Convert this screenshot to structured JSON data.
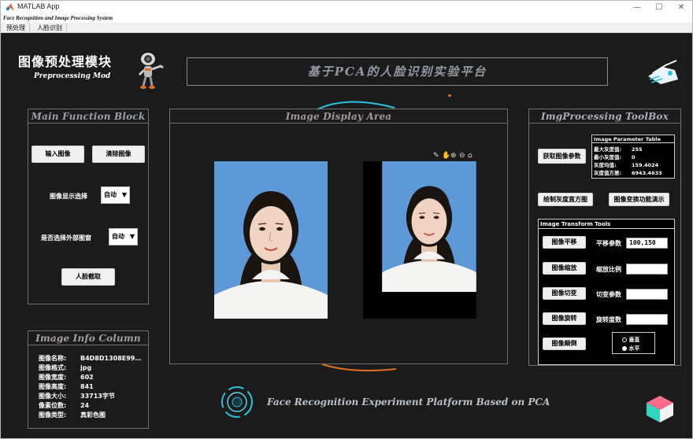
{
  "window": {
    "title": "MATLAB App",
    "figure_name": "Face Recognition and Image Processing System"
  },
  "window_controls": {
    "minimize": "—",
    "maximize": "☐",
    "close": "✕"
  },
  "menu": [
    "预处理",
    "人脸识别"
  ],
  "header": {
    "module_title": "图像预处理模块",
    "module_subtitle": "Preprocessing Mod",
    "banner_title": "基于PCA的人脸识别实验平台"
  },
  "main_function": {
    "title": "Main Function Block",
    "input_button": "输入图像",
    "clear_button": "清除图像",
    "display_select_label": "图像显示选择",
    "display_select_value": "自动",
    "external_window_label": "是否选择外部图窗",
    "external_window_value": "自动",
    "face_crop_button": "人脸截取"
  },
  "image_info": {
    "title": "Image Info Column",
    "rows": [
      {
        "key": "图像名称:",
        "value": "B4D8D1308E99…"
      },
      {
        "key": "图像格式:",
        "value": "jpg"
      },
      {
        "key": "图像宽度:",
        "value": "602"
      },
      {
        "key": "图像高度:",
        "value": "841"
      },
      {
        "key": "图像大小:",
        "value": "33713字节"
      },
      {
        "key": "像素位数:",
        "value": "24"
      },
      {
        "key": "图像类型:",
        "value": "真彩色图"
      }
    ]
  },
  "display_area": {
    "title": "Image Display Area",
    "toolbar_icons": [
      "brush-icon",
      "pan-icon",
      "zoom-in-icon",
      "zoom-out-icon",
      "home-icon"
    ]
  },
  "toolbox": {
    "title": "ImgProcessing ToolBox",
    "get_params_button": "获取图像参数",
    "param_table": {
      "title": "Image Parameter Table",
      "rows": [
        {
          "key": "最大灰度值:",
          "value": "255"
        },
        {
          "key": "最小灰度值:",
          "value": "0"
        },
        {
          "key": "灰度均值:",
          "value": "159.4024"
        },
        {
          "key": "灰度值方差:",
          "value": "6943.4633"
        }
      ]
    },
    "histogram_button": "绘制灰度直方图",
    "transform_demo_button": "图像变换功能演示"
  },
  "transform_tools": {
    "title": "Image Transform Tools",
    "translate_button": "图像平移",
    "translate_label": "平移参数",
    "translate_value": "100,150",
    "scale_button": "图像缩放",
    "scale_label": "缩放比例",
    "scale_value": "",
    "shear_button": "图像切变",
    "shear_label": "切变参数",
    "shear_value": "",
    "rotate_button": "图像旋转",
    "rotate_label": "旋转度数",
    "rotate_value": "",
    "flip_button": "图像颠倒",
    "flip_options": [
      "垂直",
      "水平"
    ]
  },
  "footer": {
    "title": "Face Recognition Experiment Platform Based on PCA"
  },
  "colors": {
    "canvas": "#1b1b1b",
    "panel_border": "#6f6f6f",
    "panel_title": "#9aa2aa",
    "accent_orange": "#e07020",
    "accent_cyan": "#27c4e0"
  }
}
